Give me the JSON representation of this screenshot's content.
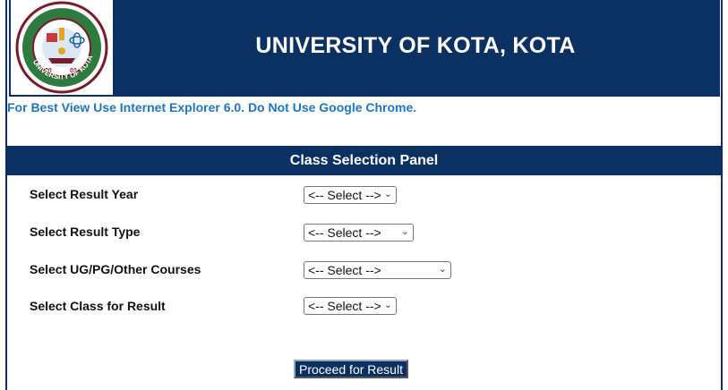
{
  "header": {
    "title": "UNIVERSITY OF KOTA, KOTA",
    "logo_text": "UNIVERSITY OF KOTA · KOTA · 2003"
  },
  "notice": "For Best View Use Internet Explorer 6.0. Do Not Use Google Chrome.",
  "panel": {
    "title": "Class Selection Panel",
    "fields": [
      {
        "label": "Select Result Year",
        "value": "<-- Select -->"
      },
      {
        "label": "Select Result Type",
        "value": "<-- Select -->"
      },
      {
        "label": "Select UG/PG/Other Courses",
        "value": "<-- Select -->"
      },
      {
        "label": "Select Class for Result",
        "value": "<-- Select -->"
      }
    ],
    "proceed_label": "Proceed for Result"
  },
  "colors": {
    "navy": "#0b3163",
    "notice_blue": "#1f76be",
    "logo_green": "#2f7a3e",
    "logo_maroon": "#7a1b2b"
  }
}
